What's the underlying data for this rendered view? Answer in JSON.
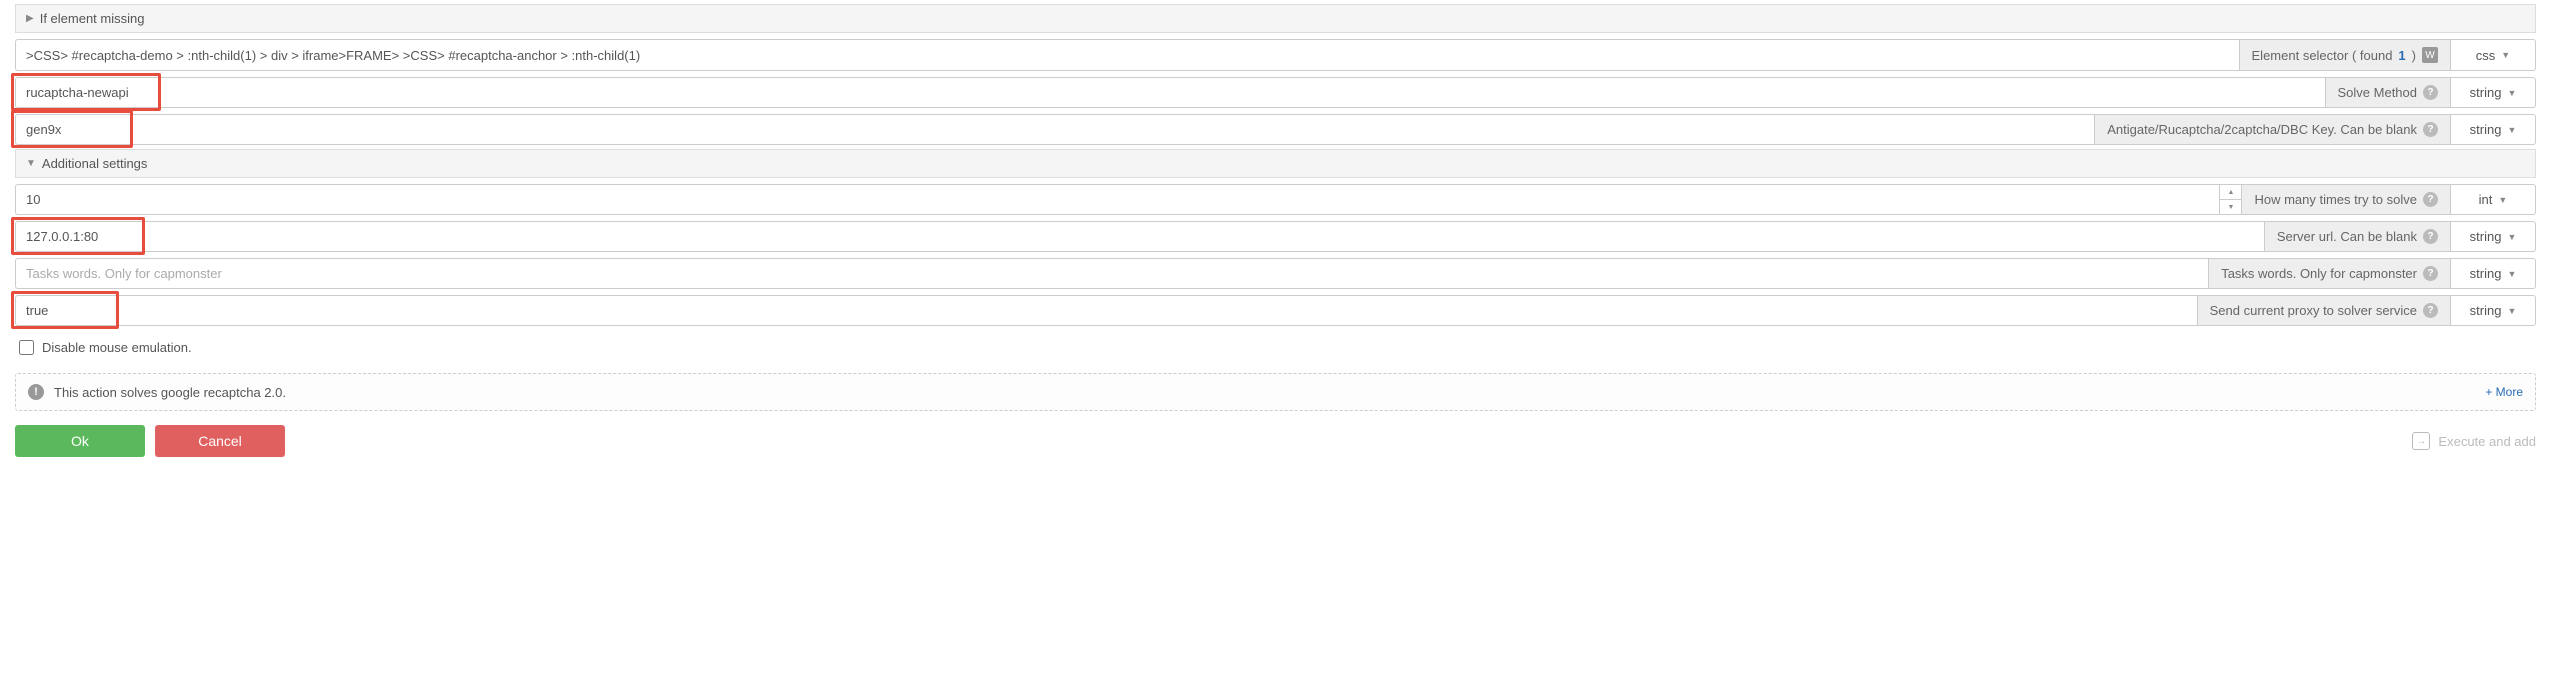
{
  "sections": {
    "if_missing": "If element missing",
    "additional": "Additional settings"
  },
  "rows": {
    "selector": {
      "value": ">CSS> #recaptcha-demo > :nth-child(1) > div > iframe>FRAME> >CSS> #recaptcha-anchor > :nth-child(1)",
      "label_prefix": "Element selector ( found ",
      "found": "1",
      "label_suffix": " )",
      "type": "css"
    },
    "method": {
      "value": "rucaptcha-newapi",
      "label": "Solve Method",
      "type": "string"
    },
    "key": {
      "value": "gen9x",
      "label": "Antigate/Rucaptcha/2captcha/DBC Key. Can be blank",
      "type": "string"
    },
    "tries": {
      "value": "10",
      "label": "How many times try to solve",
      "type": "int"
    },
    "server": {
      "value": "127.0.0.1:80",
      "label": "Server url. Can be blank",
      "type": "string"
    },
    "tasks": {
      "value": "",
      "placeholder": "Tasks words. Only for capmonster",
      "label": "Tasks words. Only for capmonster",
      "type": "string"
    },
    "proxy": {
      "value": "true",
      "label": "Send current proxy to solver service",
      "type": "string"
    }
  },
  "checkbox": {
    "label": "Disable mouse emulation."
  },
  "info": {
    "text": "This action solves google recaptcha 2.0.",
    "more": "+ More"
  },
  "buttons": {
    "ok": "Ok",
    "cancel": "Cancel",
    "exec": "Execute and add"
  }
}
